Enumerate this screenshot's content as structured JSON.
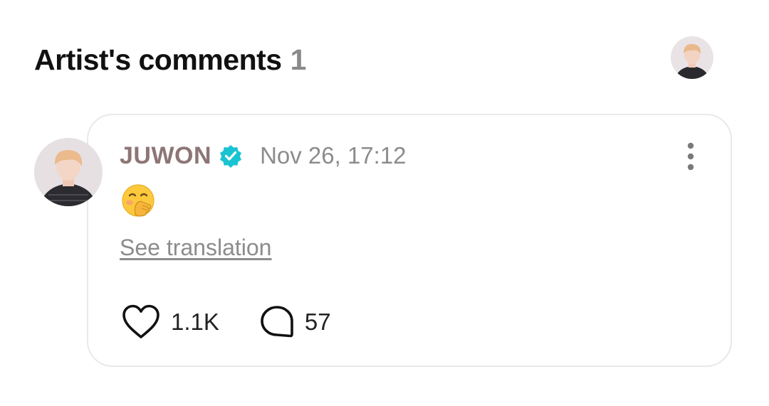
{
  "header": {
    "title": "Artist's comments",
    "count": "1"
  },
  "comment": {
    "author": "JUWON",
    "timestamp": "Nov 26, 17:12",
    "emoji_icon": "hand-over-mouth-emoji",
    "see_translation": "See translation",
    "likes": "1.1K",
    "replies": "57"
  },
  "colors": {
    "author": "#8d7676",
    "verified": "#19c3d1",
    "muted": "#8c8c8c",
    "card_border": "#e9e9e9"
  }
}
